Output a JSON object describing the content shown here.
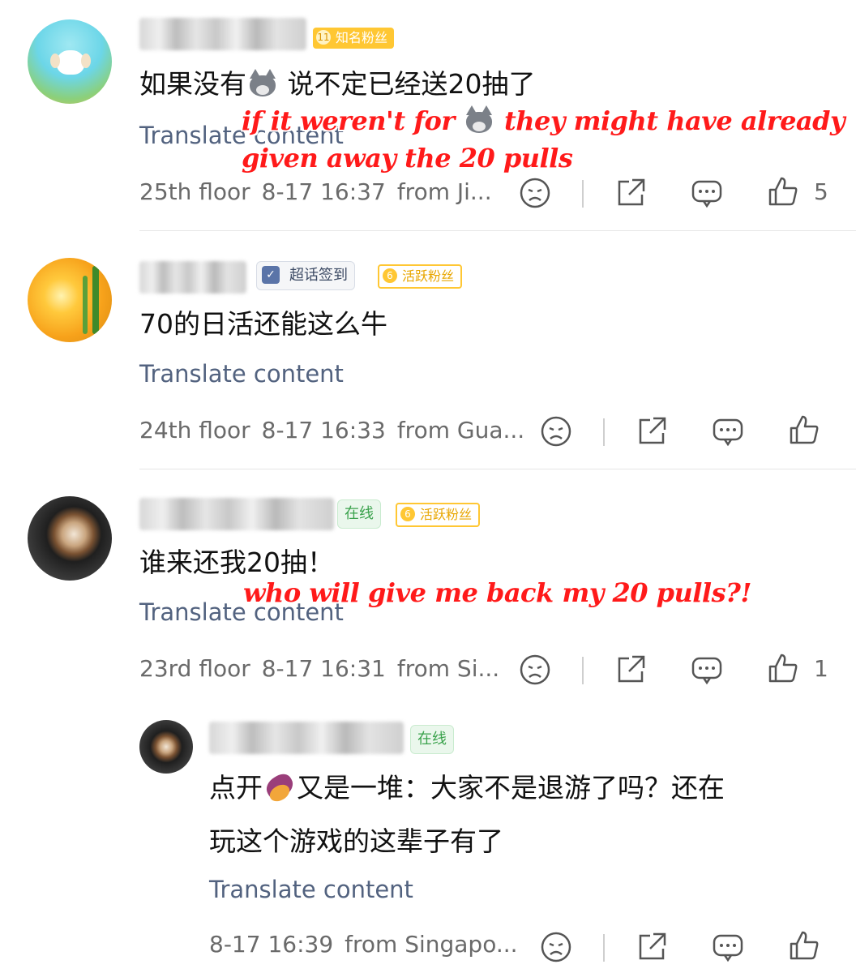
{
  "comments": [
    {
      "badges": [
        "知名粉丝"
      ],
      "badge_levels": [
        "11"
      ],
      "content_before": "如果没有",
      "emoji": "wolf-emoji",
      "content_after": "说不定已经送20抽了",
      "overlay_line1_a": "if it weren't for",
      "overlay_line1_b": "they might have already",
      "overlay_line2": "given away the 20 pulls",
      "translate": "Translate content",
      "floor": "25th floor",
      "time": "8-17 16:37",
      "from": "from Ji...",
      "likes": "5"
    },
    {
      "badges": [
        "超话签到",
        "活跃粉丝"
      ],
      "badge_levels": [
        "",
        "6"
      ],
      "content": "70的日活还能这么牛",
      "translate": "Translate content",
      "floor": "24th floor",
      "time": "8-17 16:33",
      "from": "from Gua...",
      "likes": ""
    },
    {
      "badges": [
        "在线",
        "活跃粉丝"
      ],
      "badge_levels": [
        "",
        "6"
      ],
      "content": "谁来还我20抽！",
      "overlay": "who will give me back my 20 pulls?!",
      "translate": "Translate content",
      "floor": "23rd floor",
      "time": "8-17 16:31",
      "from": "from Si...",
      "likes": "1"
    }
  ],
  "reply": {
    "badges": [
      "在线"
    ],
    "content_before": "点开",
    "emoji": "sweet-potato-emoji",
    "content_after": "又是一堆：大家不是退游了吗？还在",
    "content_line2": "玩这个游戏的这辈子有了",
    "translate": "Translate content",
    "time": "8-17 16:39",
    "from": "from Singapo...",
    "likes": ""
  },
  "colors": {
    "overlay_text": "#ff1a1a",
    "translate_link": "#52627f",
    "fan_badge": "#ffc733",
    "online_badge": "#3aa24c"
  }
}
